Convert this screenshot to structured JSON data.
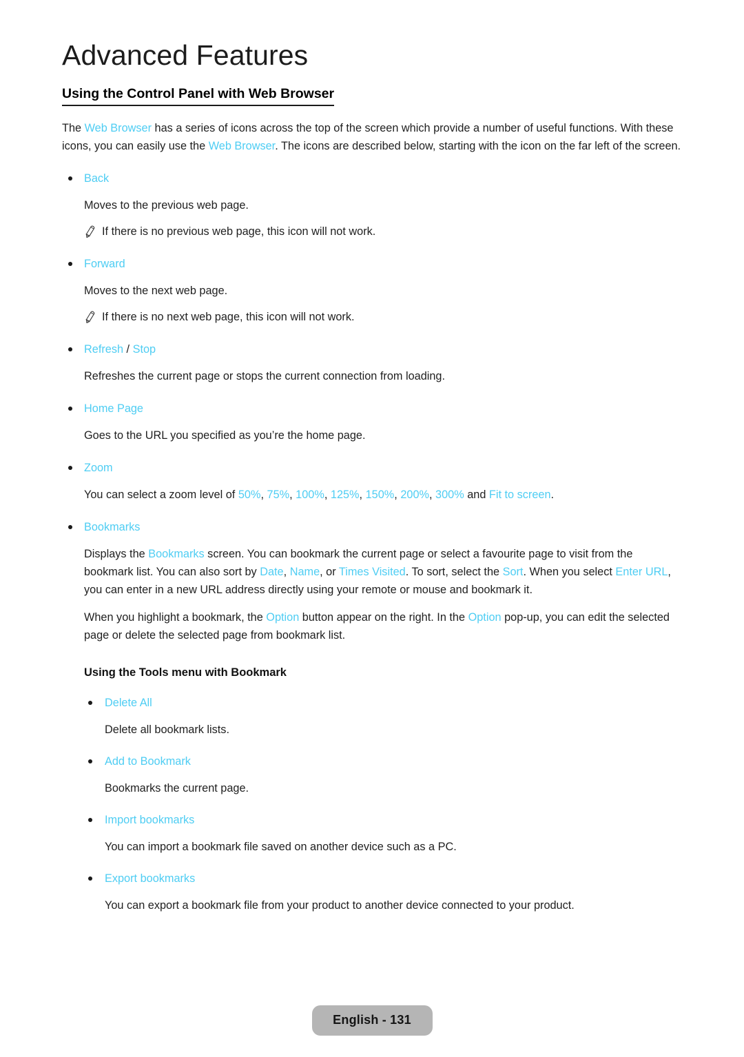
{
  "colors": {
    "highlight": "#4ecdf3",
    "text": "#1f1f1f",
    "pill_background": "#b5b5b5"
  },
  "chapter": {
    "title": "Advanced Features"
  },
  "section": {
    "heading": "Using the Control Panel with Web Browser"
  },
  "intro": {
    "part1": "The ",
    "term1": "Web Browser",
    "part2": " has a series of icons across the top of the screen which provide a number of useful functions. With these icons, you can easily use the ",
    "term2": "Web Browser",
    "part3": ". The icons are described below, starting with the icon on the far left of the screen."
  },
  "items": [
    {
      "label": "Back",
      "description": "Moves to the previous web page.",
      "note": "If there is no previous web page, this icon will not work."
    },
    {
      "label": "Forward",
      "description": "Moves to the next web page.",
      "note": "If there is no next web page, this icon will not work."
    },
    {
      "label": "Refresh",
      "separator": " / ",
      "label2": "Stop",
      "description": "Refreshes the current page or stops the current connection from loading."
    },
    {
      "label": "Home Page",
      "description": "Goes to the URL you specified as you’re the home page."
    },
    {
      "label": "Zoom"
    }
  ],
  "zoom": {
    "lead": "You can select a zoom level of ",
    "levels": [
      "50%",
      "75%",
      "100%",
      "125%",
      "150%",
      "200%",
      "300%"
    ],
    "conjunction": " and ",
    "last_option": "Fit to screen",
    "trailing": "."
  },
  "bookmarks": {
    "label": "Bookmarks",
    "p1": {
      "s1": "Displays the ",
      "t1": "Bookmarks",
      "s2": " screen. You can bookmark the current page or select a favourite page to visit from the bookmark list. You can also sort by ",
      "t2": "Date",
      "s3": ", ",
      "t3": "Name",
      "s4": ", or ",
      "t4": "Times Visited",
      "s5": ". To sort, select the ",
      "t5": "Sort",
      "s6": ". When you select ",
      "t6": "Enter URL",
      "s7": ", you can enter in a new URL address directly using your remote or mouse and bookmark it."
    },
    "p2": {
      "s1": "When you highlight a bookmark, the ",
      "t1": "Option",
      "s2": " button appear on the right. In the ",
      "t2": "Option",
      "s3": " pop-up, you can edit the selected page or delete the selected page from bookmark list."
    }
  },
  "tools_menu": {
    "heading": "Using the Tools menu with Bookmark",
    "items": [
      {
        "label": "Delete All",
        "description": "Delete all bookmark lists."
      },
      {
        "label": "Add to Bookmark",
        "description": "Bookmarks the current page."
      },
      {
        "label": "Import bookmarks",
        "description": "You can import a bookmark file saved on another device such as a PC."
      },
      {
        "label": "Export bookmarks",
        "description": "You can export a bookmark file from your product to another device connected to your product."
      }
    ]
  },
  "footer": {
    "page_label": "English - 131"
  }
}
